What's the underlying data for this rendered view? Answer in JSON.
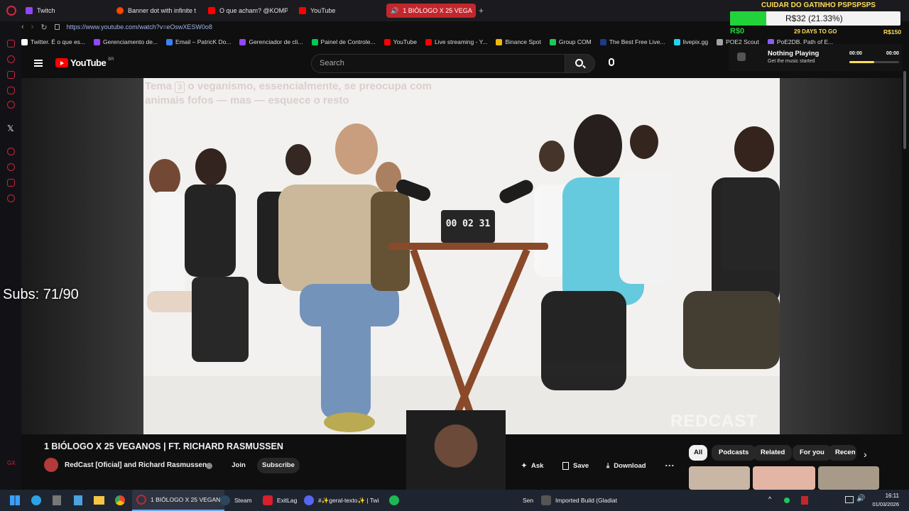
{
  "browser": {
    "tabs": [
      {
        "label": "Twitch",
        "color": "#9146ff"
      },
      {
        "label": "Banner dot with infinite ta",
        "color": "#ff4500"
      },
      {
        "label": "O que acham? @KOMPBR",
        "color": "#ff0000"
      },
      {
        "label": "YouTube",
        "color": "#ff0000"
      },
      {
        "label": "1 BIÓLOGO X 25 VEGA",
        "color": "#ffffff",
        "active": true
      }
    ],
    "new_tab": "+",
    "url": "https://www.youtube.com/watch?v=eOswXESW0o8",
    "bookmarks": [
      {
        "label": "Twitter. É o que es...",
        "color": "#ffffff",
        "icon": "x-icon"
      },
      {
        "label": "Gerenciamento de...",
        "color": "#9146ff"
      },
      {
        "label": "Email – PatricK Do...",
        "color": "#3b82f6"
      },
      {
        "label": "Gerenciador de cli...",
        "color": "#9146ff"
      },
      {
        "label": "Painel de Controle...",
        "color": "#00c853"
      },
      {
        "label": "YouTube",
        "color": "#ff0000"
      },
      {
        "label": "Live streaming - Y...",
        "color": "#ff0000"
      },
      {
        "label": "Binance Spot",
        "color": "#f0b90b"
      },
      {
        "label": "Group COM",
        "color": "#22c55e"
      },
      {
        "label": "The Best Free Live...",
        "color": "#1e3a8a"
      },
      {
        "label": "livepix.gg",
        "color": "#22d3ee"
      },
      {
        "label": "POE2 Scout",
        "color": "#a3a3a3"
      },
      {
        "label": "PoE2DB, Path of E...",
        "color": "#8b5cf6"
      }
    ]
  },
  "youtube": {
    "logo_text": "YouTube",
    "logo_region": "BR",
    "search_placeholder": "Search",
    "video": {
      "caption_prefix": "Tema",
      "caption_num": "3",
      "caption_rest": "o veganismo, essencialmente, se preocupa com animais fofos — mas — esquece o resto",
      "timer": "00 02 31",
      "watermark": "REDCAST",
      "mic_label": "REDCAST"
    },
    "title": "1 BIÓLOGO X 25 VEGANOS | FT. RICHARD RASMUSSEN",
    "channel": "RedCast [Oficial] and Richard Rasmussen",
    "join": "Join",
    "subscribe": "Subscribe",
    "actions": {
      "ask": "Ask",
      "save": "Save",
      "download": "Download",
      "more": "⋮"
    },
    "chips": [
      "All",
      "Podcasts",
      "Related",
      "For you",
      "Recen"
    ]
  },
  "overlay": {
    "donation_title": "CUIDAR DO GATINHO PSPSPSPS",
    "donation_amount": "R$32 (21.33%)",
    "donation_progress": 0.2133,
    "donation_min": "R$0",
    "donation_max": "R$150",
    "donation_days": "29 DAYS TO GO",
    "now_playing_title": "Nothing Playing",
    "now_playing_sub": "Get the music started",
    "time_left": "00:00",
    "time_right": "00:00",
    "subs": "Subs: 71/90"
  },
  "taskbar": {
    "items": [
      {
        "label": "1 BIÓLOGO X 25 VEGAN",
        "color": "#c1272d"
      },
      {
        "label": "Steam",
        "color": "#1b2838"
      },
      {
        "label": "ExitLag",
        "color": "#d6202b"
      },
      {
        "label": "#✨geral-texto✨ | Twi",
        "color": "#5865f2"
      },
      {
        "label": "Sen",
        "color": "#1db954"
      },
      {
        "label": "Imported Build (Gladiat",
        "color": "#444444"
      }
    ],
    "time": "16:11",
    "date": "01/03/2026"
  }
}
